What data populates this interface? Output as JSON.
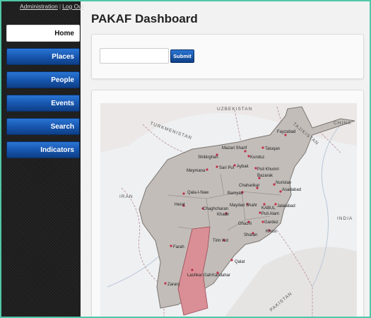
{
  "header": {
    "admin_link": "Administration",
    "separator": "|",
    "logout_link": "Log Out"
  },
  "sidebar": {
    "items": [
      {
        "label": "Home",
        "active": true
      },
      {
        "label": "Places"
      },
      {
        "label": "People"
      },
      {
        "label": "Events"
      },
      {
        "label": "Search"
      },
      {
        "label": "Indicators"
      }
    ]
  },
  "main": {
    "title": "PAKAF Dashboard",
    "search": {
      "value": "",
      "placeholder": "",
      "submit_label": "Submit"
    }
  },
  "map": {
    "countries": [
      "TURKMENISTAN",
      "UZBEKISTAN",
      "TAJIKISTAN",
      "CHINA",
      "IRAN",
      "INDIA",
      "PAKISTAN"
    ],
    "cities": [
      "Fayzabad",
      "Mazari Sharif",
      "Taluqan",
      "Kunduz",
      "Shibirghan",
      "Sari Pul",
      "Aybak",
      "Puli Khumri",
      "Meymana",
      "Bazarak",
      "Qala-I-Naw",
      "Chaharikar",
      "Nuristan",
      "Bamyan",
      "Asadabad",
      "Herat",
      "Chaghcharan",
      "Maydan Shahr",
      "KABUL",
      "Jalalabad",
      "Khadir",
      "Puli Alam",
      "Ghazni",
      "Gardez",
      "Khost",
      "Sharan",
      "Farah",
      "Tirin Kot",
      "Lashkar Gah",
      "Qalat",
      "Kandahar",
      "Zaranj"
    ],
    "colors": {
      "afghanistan": "#c2bdb9",
      "highlight": "#d98f95",
      "ocean": "#eef0f2",
      "marker": "#c0304a"
    }
  }
}
